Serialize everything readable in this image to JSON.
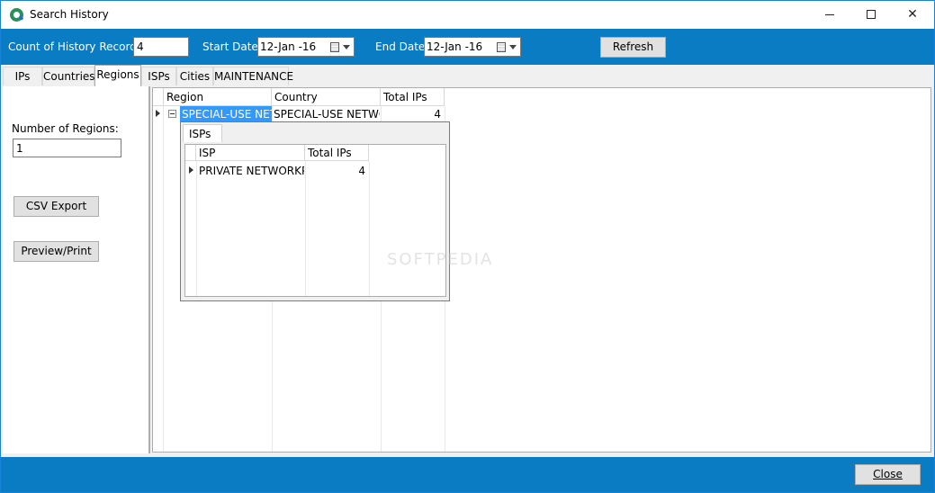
{
  "window": {
    "title": "Search History"
  },
  "toolbar": {
    "count_label": "Count of History Records:",
    "count_value": "4",
    "start_label": "Start Date:",
    "start_value": "12-Jan -16",
    "end_label": "End Date:",
    "end_value": "12-Jan -16",
    "refresh_label": "Refresh"
  },
  "tabs": [
    "IPs",
    "Countries",
    "Regions",
    "ISPs",
    "Cities",
    "MAINTENANCE"
  ],
  "active_tab": "Regions",
  "left": {
    "regions_label": "Number of Regions:",
    "regions_value": "1",
    "csv_label": "CSV Export",
    "preview_label": "Preview/Print"
  },
  "grid": {
    "headers": [
      "Region",
      "Country",
      "Total IPs"
    ],
    "row": {
      "region": "SPECIAL-USE NETWORK",
      "country": "SPECIAL-USE NETWORK",
      "total": "4"
    }
  },
  "detail": {
    "tab_label": "ISPs",
    "headers": [
      "ISP",
      "Total IPs"
    ],
    "row": {
      "isp": "PRIVATE NETWORKP CL",
      "total": "4"
    }
  },
  "watermark": "SOFTPEDIA",
  "footer": {
    "close_label": "Close"
  },
  "colors": {
    "accent": "#0a7cc3",
    "selection": "#3399ff"
  }
}
